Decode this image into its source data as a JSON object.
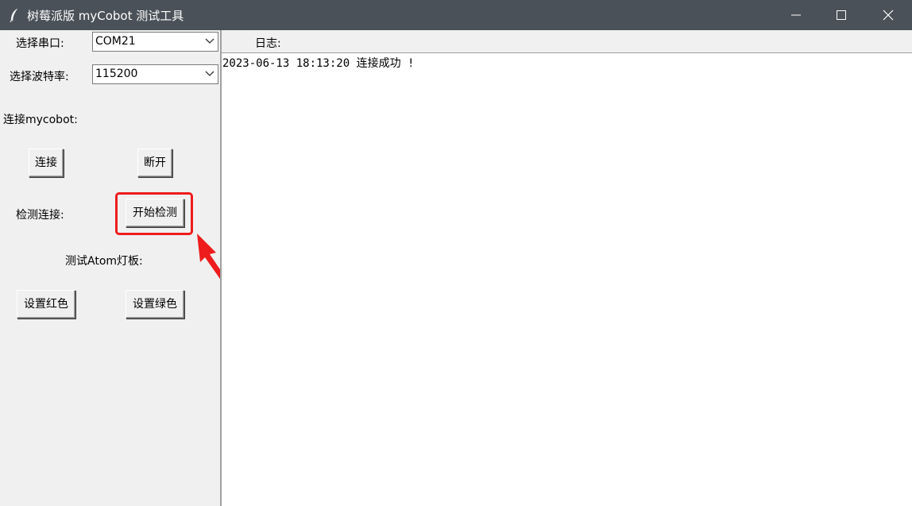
{
  "window": {
    "title": "树莓派版 myCobot 测试工具"
  },
  "serial": {
    "port_label": "选择串口:",
    "port_value": "COM21",
    "baud_label": "选择波特率:",
    "baud_value": "115200"
  },
  "connection": {
    "section_label": "连接mycobot:",
    "connect_label": "连接",
    "disconnect_label": "断开"
  },
  "detect": {
    "label": "检测连接:",
    "start_label": "开始检测"
  },
  "atom": {
    "section_label": "测试Atom灯板:",
    "red_label": "设置红色",
    "green_label": "设置绿色"
  },
  "log": {
    "header": "日志:",
    "lines": [
      "2023-06-13 18:13:20 连接成功 !"
    ]
  },
  "colors": {
    "titlebar": "#4a5158",
    "highlight": "#ee1c1c",
    "arrow": "#ee1c1c"
  },
  "icons": {
    "app": "feather-icon",
    "minimize": "minimize-icon",
    "maximize": "maximize-icon",
    "close": "close-icon",
    "dropdown": "chevron-down-icon"
  }
}
